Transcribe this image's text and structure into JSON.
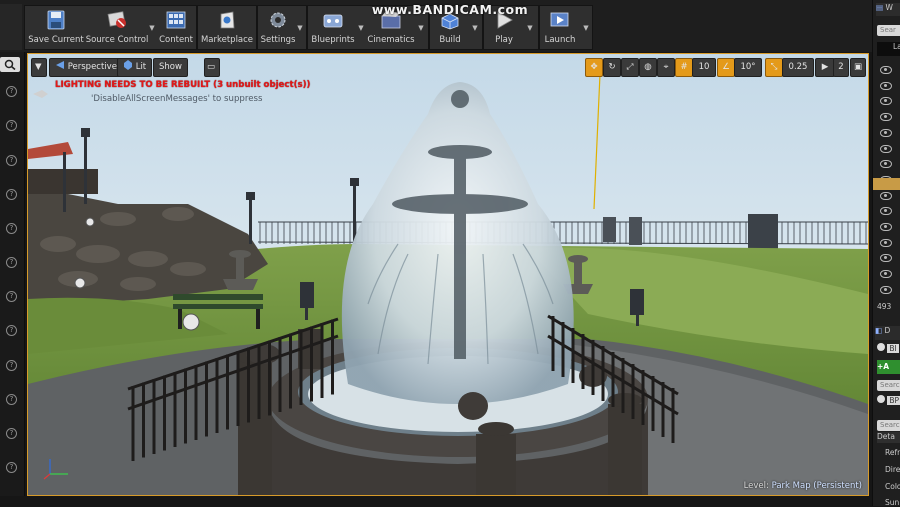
{
  "watermark": "www.BANDICAM.com",
  "toolbar": {
    "save_current": "Save Current",
    "source_control": "Source Control",
    "content": "Content",
    "marketplace": "Marketplace",
    "settings": "Settings",
    "blueprints": "Blueprints",
    "cinematics": "Cinematics",
    "build": "Build",
    "play": "Play",
    "launch": "Launch"
  },
  "viewport": {
    "perspective": "Perspective",
    "lit": "Lit",
    "show": "Show",
    "grid_snap": "10",
    "rotation_snap": "10°",
    "scale_snap": "0.25",
    "camera_speed": "2",
    "warning": "LIGHTING NEEDS TO BE REBUILT (3 unbuilt object(s))",
    "suppress_hint": "'DisableAllScreenMessages' to suppress",
    "level_label": "Level:",
    "level_name": "Park Map (Persistent)"
  },
  "right_panel": {
    "count": "493",
    "row_d": "D",
    "row_b1": "BI",
    "row_add": "+A",
    "row_search": "Searc",
    "row_b2": "BP",
    "row_search2": "Searc",
    "row_det": "Deta",
    "row_refr": "Refr",
    "row_dire": "Dire",
    "row_colo": "Colo",
    "row_sun": "Sun",
    "top_search": "Sear",
    "top_label": "La",
    "top_tab": "W"
  },
  "colors": {
    "accent": "#e49a1a",
    "warning": "#e61717",
    "selection_border": "#d79b2a"
  }
}
